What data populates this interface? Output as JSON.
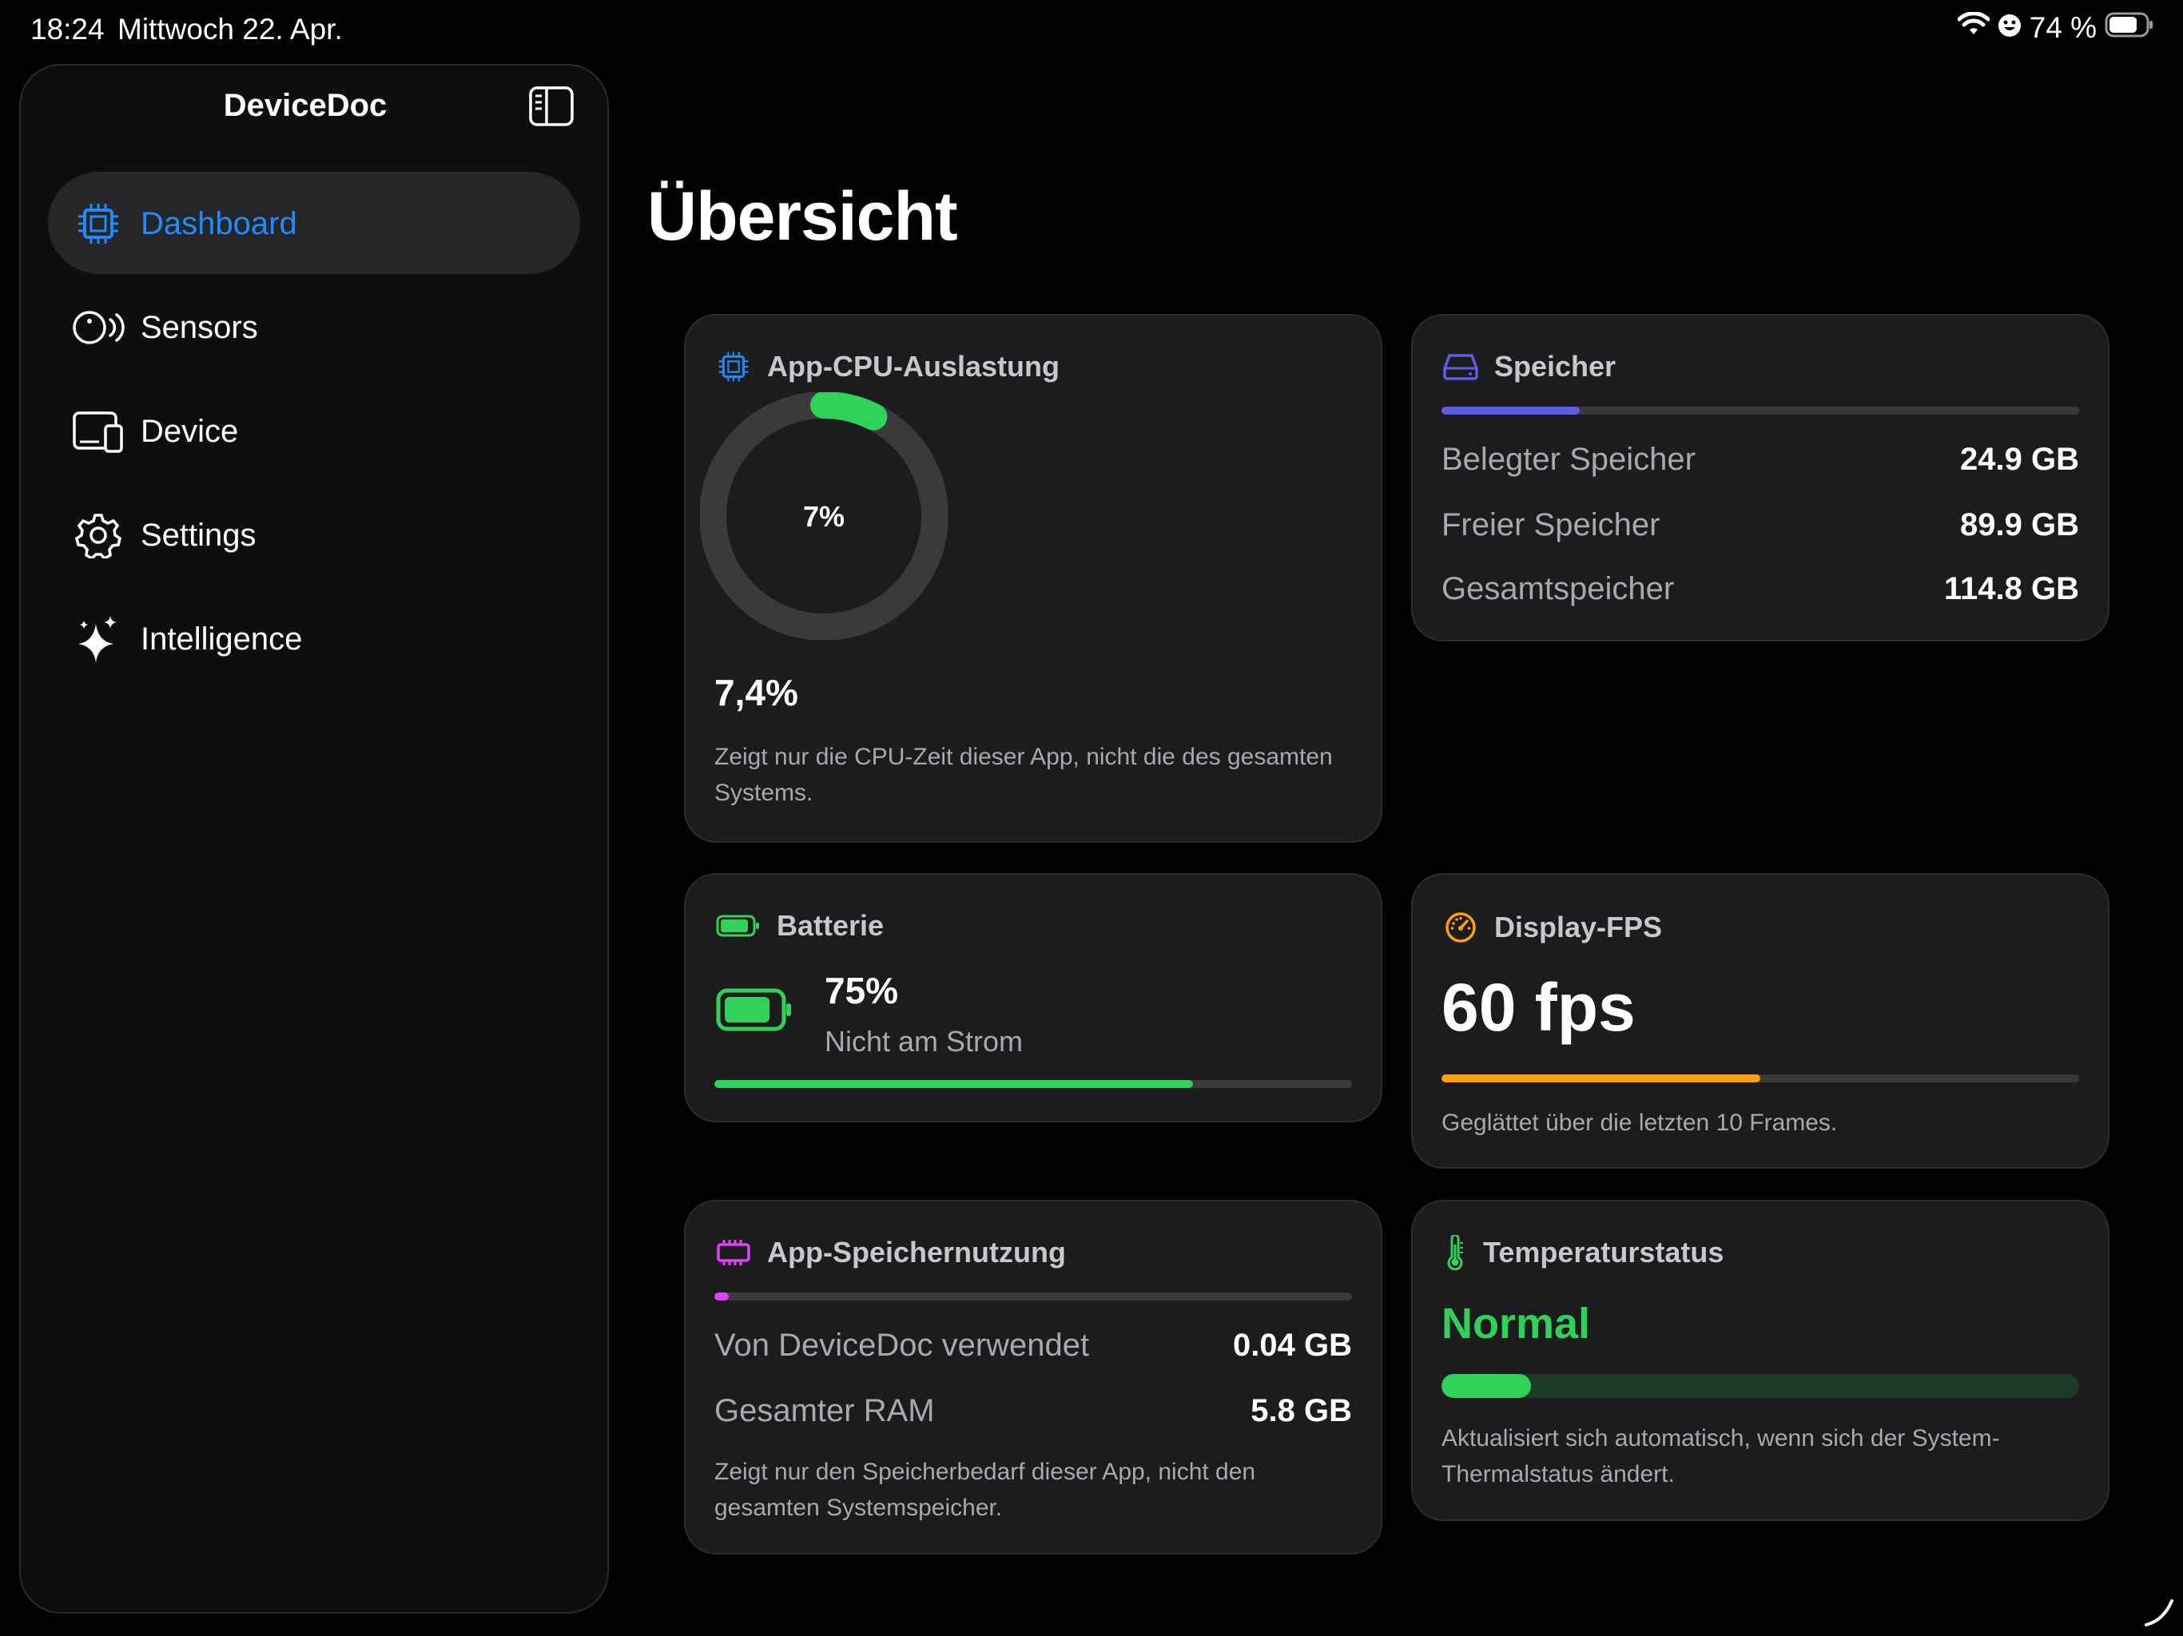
{
  "status": {
    "time": "18:24",
    "date": "Mittwoch 22. Apr.",
    "battery": "74 %"
  },
  "sidebar": {
    "title": "DeviceDoc",
    "items": [
      {
        "label": "Dashboard",
        "icon": "cpu-icon",
        "active": true
      },
      {
        "label": "Sensors",
        "icon": "sensor-icon"
      },
      {
        "label": "Device",
        "icon": "devices-icon"
      },
      {
        "label": "Settings",
        "icon": "gear-icon"
      },
      {
        "label": "Intelligence",
        "icon": "sparkles-icon"
      }
    ]
  },
  "main": {
    "title": "Übersicht",
    "cpu": {
      "title": "App-CPU-Auslastung",
      "ring_label": "7%",
      "ring_fraction": 0.074,
      "value": "7,4%",
      "description": "Zeigt nur die CPU-Zeit dieser App, nicht die des gesamten Systems."
    },
    "storage": {
      "title": "Speicher",
      "used_fraction": 0.217,
      "rows": [
        {
          "label": "Belegter Speicher",
          "value": "24.9 GB"
        },
        {
          "label": "Freier Speicher",
          "value": "89.9 GB"
        },
        {
          "label": "Gesamtspeicher",
          "value": "114.8 GB"
        }
      ]
    },
    "battery": {
      "title": "Batterie",
      "percent": "75%",
      "state": "Nicht am Strom",
      "fraction": 0.75
    },
    "fps": {
      "title": "Display-FPS",
      "value": "60 fps",
      "fraction": 0.5,
      "description": "Geglättet über die letzten 10 Frames."
    },
    "app_memory": {
      "title": "App-Speichernutzung",
      "fraction": 0.007,
      "rows": [
        {
          "label": "Von DeviceDoc verwendet",
          "value": "0.04 GB"
        },
        {
          "label": "Gesamter RAM",
          "value": "5.8 GB"
        }
      ],
      "description": "Zeigt nur den Speicherbedarf dieser App, nicht den gesamten Systemspeicher."
    },
    "thermal": {
      "title": "Temperaturstatus",
      "state": "Normal",
      "fraction": 0.14,
      "description": "Aktualisiert sich automatisch, wenn sich der System-Thermalstatus ändert."
    }
  },
  "colors": {
    "accent_blue": "#1f8bff",
    "green": "#30d158",
    "storage_bar": "#5e5ce6",
    "fps_orange": "#ff9f0a",
    "memory_magenta": "#e040fb"
  }
}
